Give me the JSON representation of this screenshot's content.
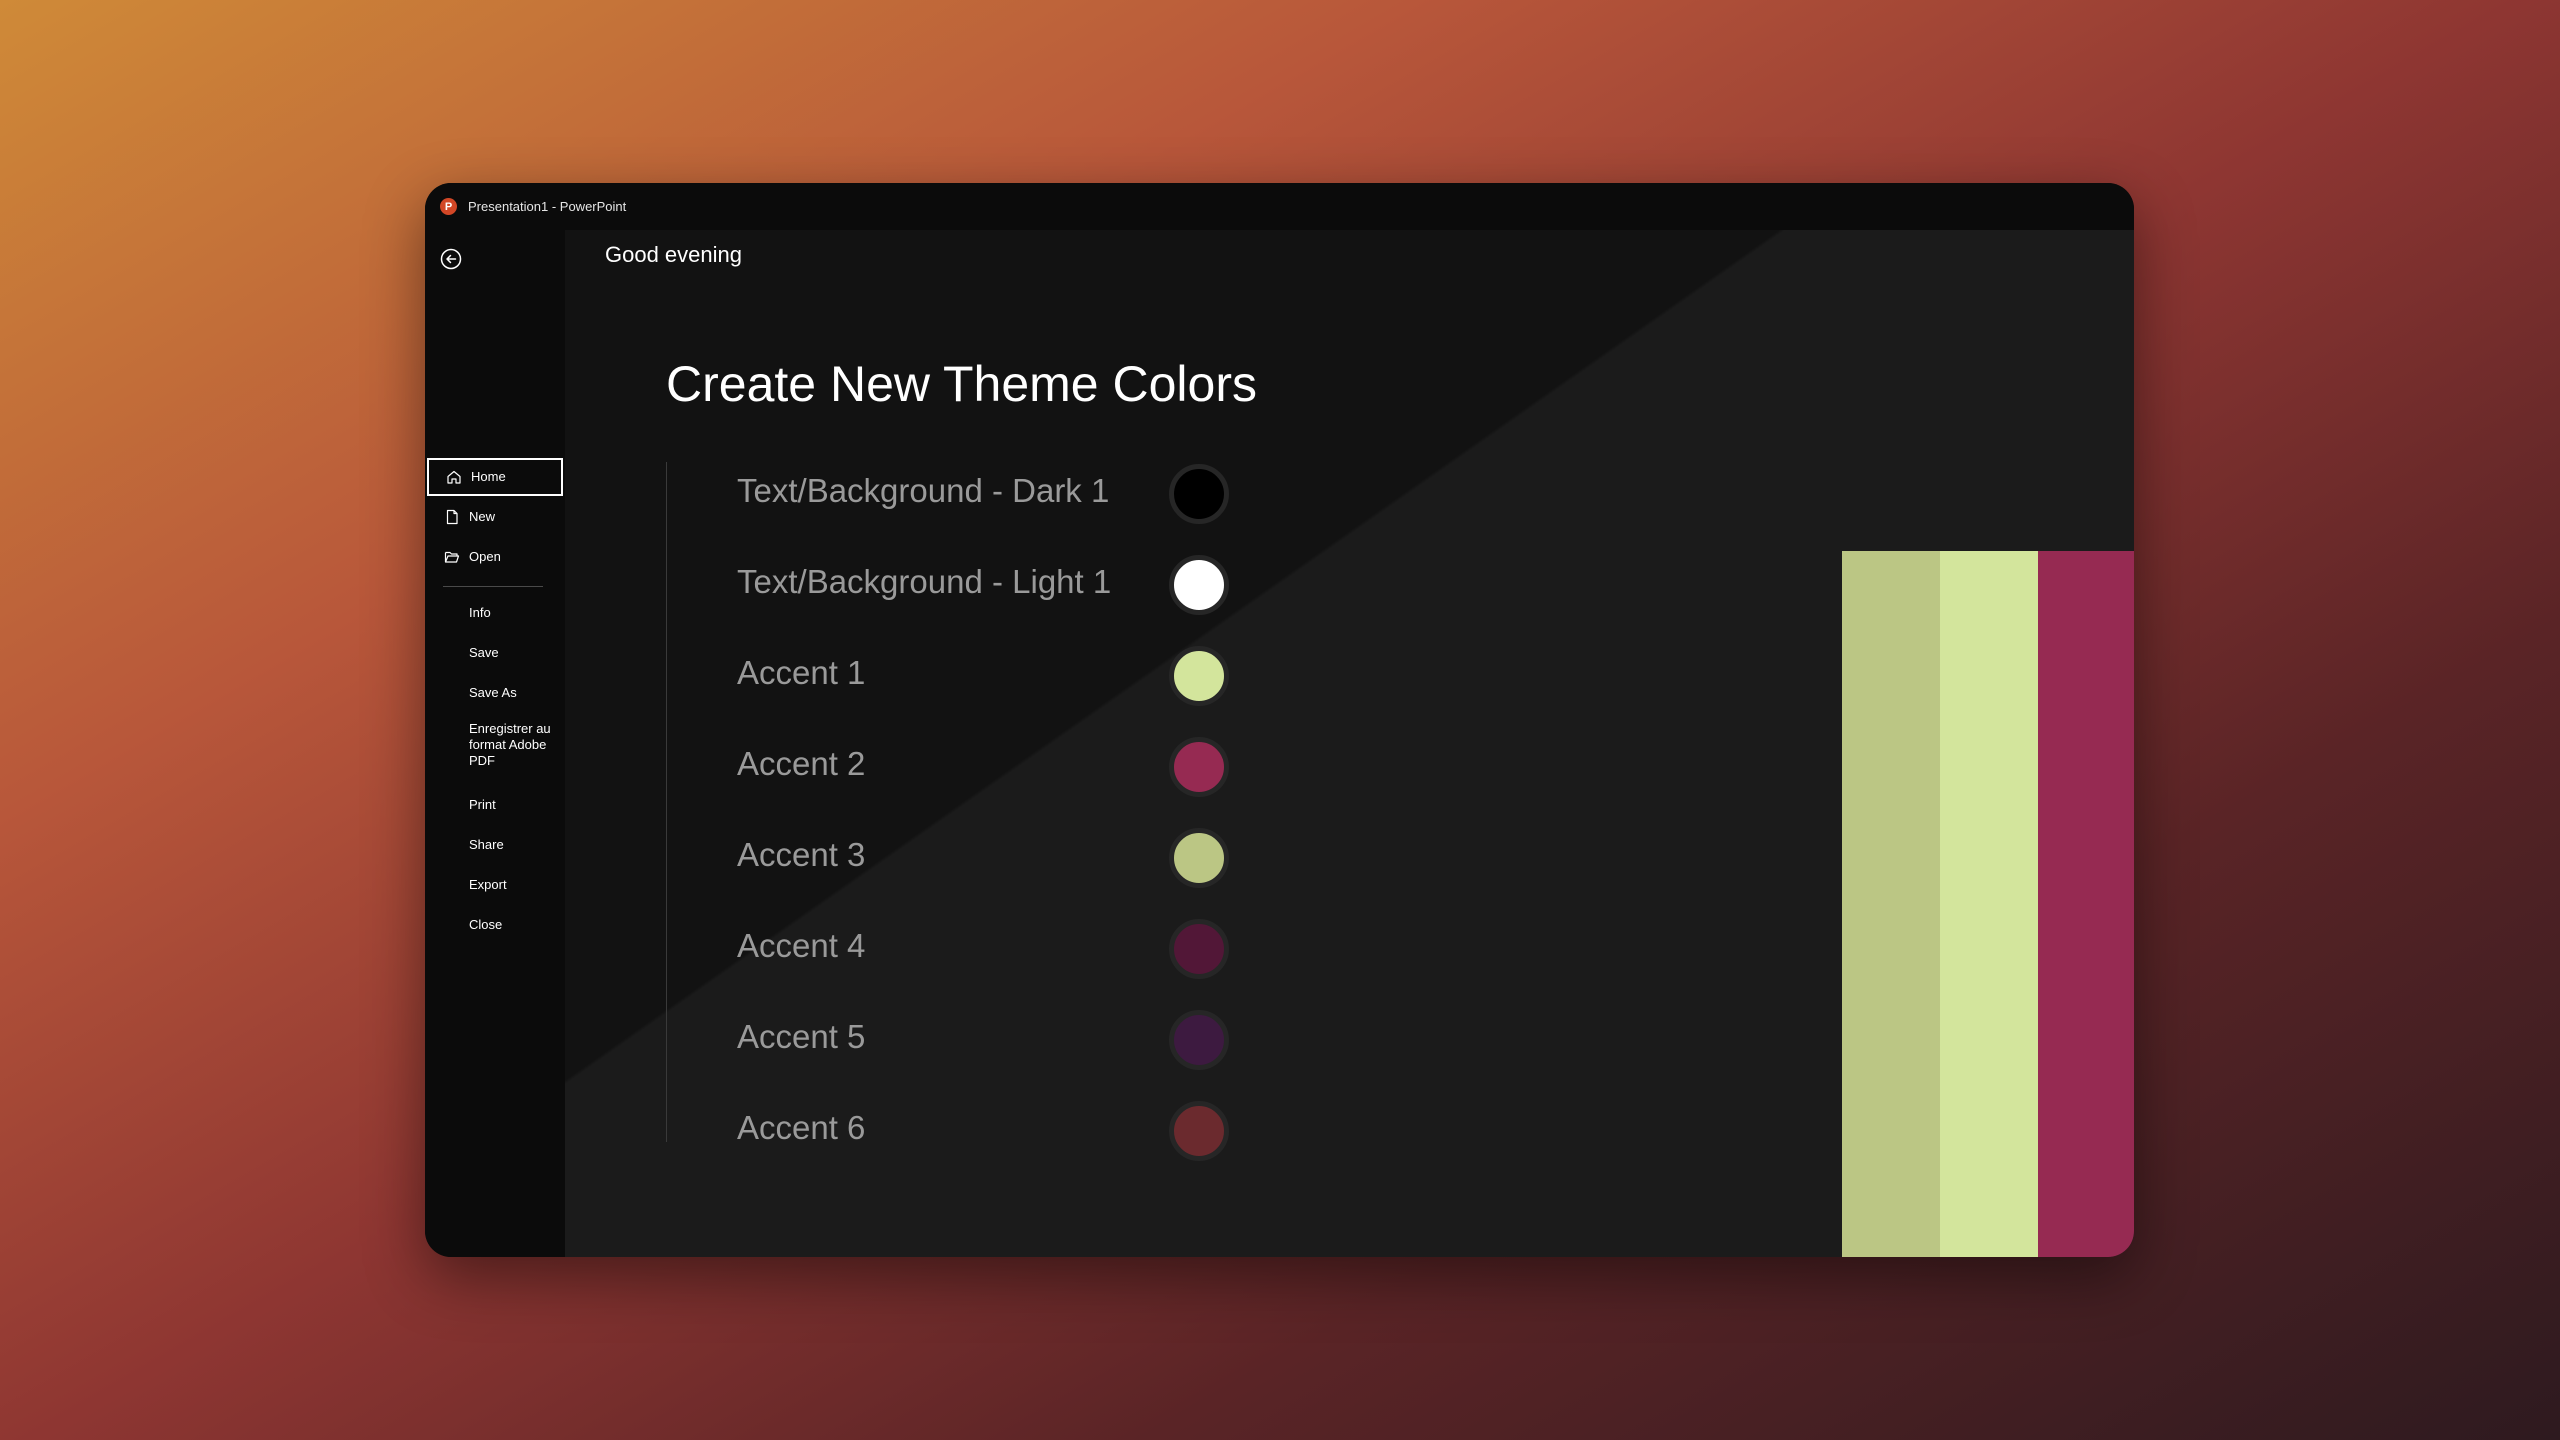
{
  "window": {
    "title": "Presentation1  -  PowerPoint",
    "app_icon": "powerpoint-logo-icon",
    "app_icon_letter": "P"
  },
  "sidebar": {
    "back_icon": "back-arrow-icon",
    "items": [
      {
        "label": "Home",
        "icon": "home-icon",
        "active": true
      },
      {
        "label": "New",
        "icon": "new-document-icon"
      },
      {
        "label": "Open",
        "icon": "open-folder-icon"
      },
      {
        "label": "Info"
      },
      {
        "label": "Save"
      },
      {
        "label": "Save As"
      },
      {
        "label": "Enregistrer au format Adobe PDF"
      },
      {
        "label": "Print"
      },
      {
        "label": "Share"
      },
      {
        "label": "Export"
      },
      {
        "label": "Close"
      }
    ]
  },
  "main": {
    "greeting": "Good evening",
    "slide_title": "Create New Theme Colors",
    "theme_colors": [
      {
        "label": "Text/Background - Dark 1",
        "color": "#000000"
      },
      {
        "label": "Text/Background - Light 1",
        "color": "#ffffff"
      },
      {
        "label": "Accent 1",
        "color": "#d3e59c"
      },
      {
        "label": "Accent 2",
        "color": "#962a52"
      },
      {
        "label": "Accent 3",
        "color": "#bbc684"
      },
      {
        "label": "Accent 4",
        "color": "#521737"
      },
      {
        "label": "Accent 5",
        "color": "#3d1a40"
      },
      {
        "label": "Accent 6",
        "color": "#6b2a2e"
      }
    ],
    "palette": [
      "#bbc684",
      "#d3e59c",
      "#962a52",
      "#521737",
      "#3d1a40"
    ]
  }
}
